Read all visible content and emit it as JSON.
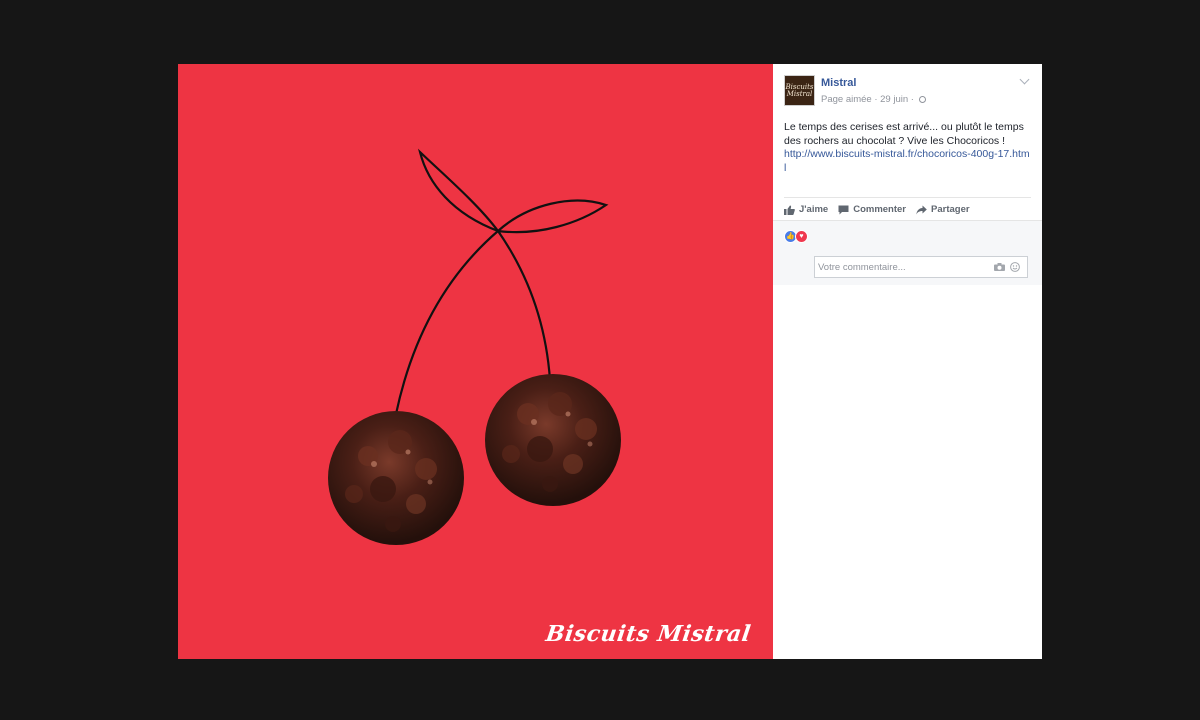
{
  "photo": {
    "background_color": "#ee3443",
    "brand_signature": "Biscuits Mistral"
  },
  "post": {
    "avatar_text": "Biscuits Mistral",
    "page_name": "Mistral",
    "meta": "Page aimée · 29 juin ·",
    "text": "Le temps des cerises est arrivé... ou plutôt le temps des rochers au chocolat ? Vive les Chocoricos !",
    "link": "http://www.biscuits-mistral.fr/chocoricos-400g-17.html",
    "link_color": "#365899"
  },
  "actions": {
    "like_label": "J'aime",
    "comment_label": "Commenter",
    "share_label": "Partager"
  },
  "reactions": [
    "like",
    "love"
  ],
  "comment_box": {
    "placeholder": "Votre commentaire..."
  }
}
